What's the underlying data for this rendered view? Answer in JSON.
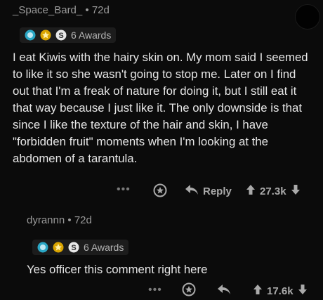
{
  "comment1": {
    "author": "_Space_Bard_",
    "age": "72d",
    "awards_label": "6 Awards",
    "body": "I eat Kiwis with the hairy skin on. My mom said I seemed to like it so she wasn't going to stop me. Later on I find out that I'm a freak of nature for doing it, but I still eat it that way because I just like it. The only downside is that since I like the texture of the hair and skin, I have \"forbidden fruit\" moments when I'm looking at the  abdomen of a tarantula.",
    "more_label": "•••",
    "reply_label": "Reply",
    "score": "27.3k"
  },
  "comment2": {
    "author": "dyrannn",
    "age": "72d",
    "awards_label": "6 Awards",
    "body": "Yes officer this comment right here",
    "more_label": "•••",
    "score": "17.6k"
  },
  "icons": [
    "avatar",
    "silver-award-icon",
    "gold-award-icon",
    "helpful-award-icon",
    "more-icon",
    "award-icon",
    "reply-icon",
    "upvote-icon",
    "downvote-icon"
  ],
  "colors": {
    "background": "#0b0b0b",
    "text": "#e6e6e6",
    "meta": "#9a9a9a",
    "icon": "#aaaaaa"
  }
}
